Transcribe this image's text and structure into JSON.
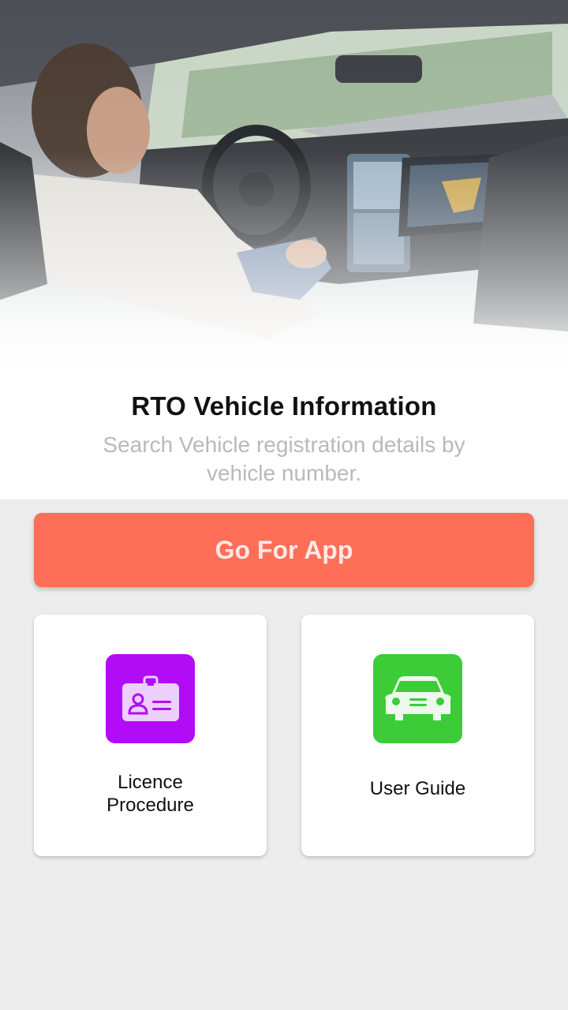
{
  "hero": {
    "image": "car-interior-photo"
  },
  "header": {
    "title": "RTO Vehicle Information",
    "subtitle": "Search Vehicle registration details by vehicle number."
  },
  "primary_action": {
    "label": "Go For App",
    "color": "#ff6e58"
  },
  "cards": [
    {
      "label_line1": "Licence",
      "label_line2": "Procedure",
      "icon": "id-card-icon",
      "color": "#b20cf6"
    },
    {
      "label": "User Guide",
      "icon": "car-icon",
      "color": "#3bcc38"
    }
  ]
}
